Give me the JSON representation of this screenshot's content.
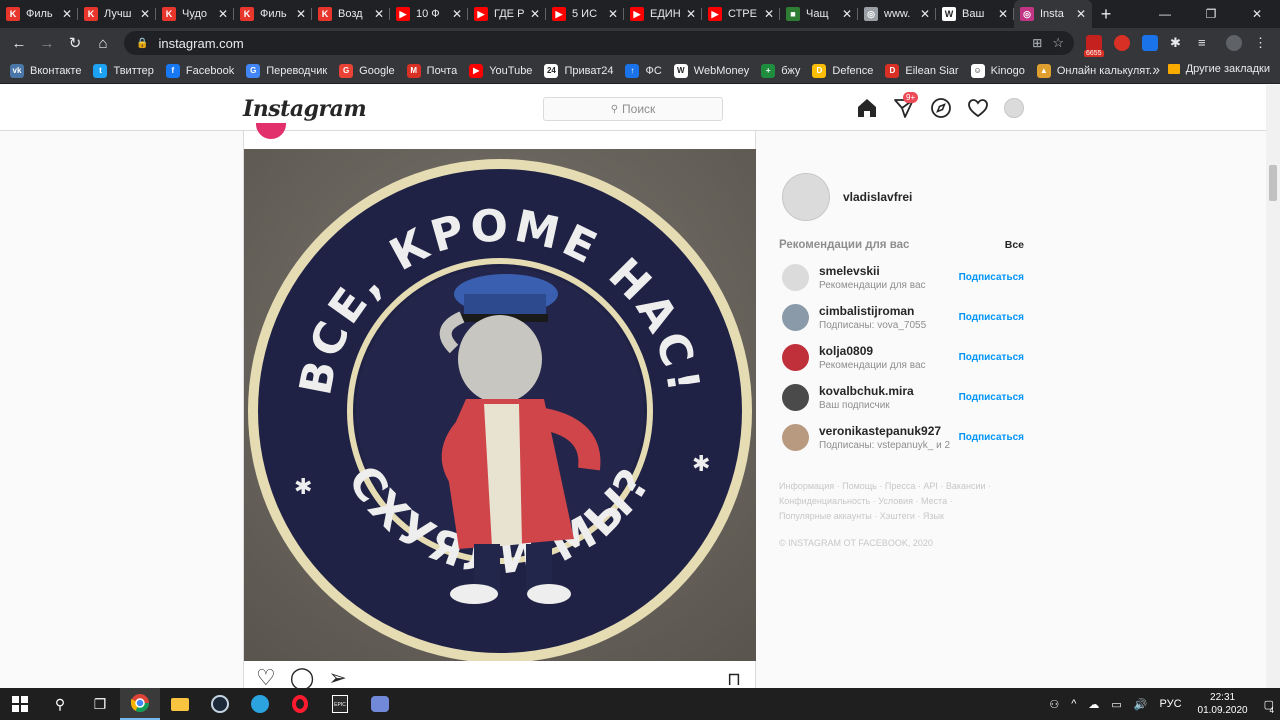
{
  "browser": {
    "tabs": [
      {
        "title": "Филь",
        "color": "#e8362d",
        "glyph": "K"
      },
      {
        "title": "Лучш",
        "color": "#e8362d",
        "glyph": "K"
      },
      {
        "title": "Чудо",
        "color": "#e8362d",
        "glyph": "K"
      },
      {
        "title": "Филь",
        "color": "#e8362d",
        "glyph": "K"
      },
      {
        "title": "Возд",
        "color": "#e8362d",
        "glyph": "K"
      },
      {
        "title": "10 Ф",
        "color": "#ff0000",
        "glyph": "▶"
      },
      {
        "title": "ГДЕ Р",
        "color": "#ff0000",
        "glyph": "▶"
      },
      {
        "title": "5 ИС",
        "color": "#ff0000",
        "glyph": "▶"
      },
      {
        "title": "ЕДИН",
        "color": "#ff0000",
        "glyph": "▶"
      },
      {
        "title": "СТРЕ",
        "color": "#ff0000",
        "glyph": "▶"
      },
      {
        "title": "Чащ",
        "color": "#2e7d32",
        "glyph": "■"
      },
      {
        "title": "www.",
        "color": "#9aa0a6",
        "glyph": "◎"
      },
      {
        "title": "Ваш",
        "color": "#ffffff",
        "glyph": "W"
      },
      {
        "title": "Insta",
        "color": "#c13584",
        "glyph": "◎"
      }
    ],
    "active_tab_index": 13,
    "url": "instagram.com",
    "ext_badge": "6655",
    "bookmarks": [
      {
        "label": "Вконтакте",
        "color": "#4a76a8",
        "glyph": "vk"
      },
      {
        "label": "Твиттер",
        "color": "#1da1f2",
        "glyph": "t"
      },
      {
        "label": "Facebook",
        "color": "#1877f2",
        "glyph": "f"
      },
      {
        "label": "Переводчик",
        "color": "#4285f4",
        "glyph": "G"
      },
      {
        "label": "Google",
        "color": "#ea4335",
        "glyph": "G"
      },
      {
        "label": "Почта",
        "color": "#d93025",
        "glyph": "M"
      },
      {
        "label": "YouTube",
        "color": "#ff0000",
        "glyph": "▶"
      },
      {
        "label": "Приват24",
        "color": "#ffffff",
        "glyph": "24"
      },
      {
        "label": "ФС",
        "color": "#1a73e8",
        "glyph": "↑"
      },
      {
        "label": "WebMoney",
        "color": "#ffffff",
        "glyph": "W"
      },
      {
        "label": "бжу",
        "color": "#1e8e3e",
        "glyph": "+"
      },
      {
        "label": "Defence",
        "color": "#fbbc04",
        "glyph": "D"
      },
      {
        "label": "Eilean Siar",
        "color": "#d93025",
        "glyph": "D"
      },
      {
        "label": "Kinogo",
        "color": "#ffffff",
        "glyph": "☺"
      },
      {
        "label": "Онлайн калькулят...",
        "color": "#e0a030",
        "glyph": "▲"
      }
    ],
    "bookmarks_more": "»",
    "other_bookmarks": "Другие закладки"
  },
  "instagram": {
    "logo": "Instagram",
    "search_placeholder": "Поиск",
    "notif_badge": "9+",
    "post": {
      "patch_top_text": "ВСЕ, КРОМЕ НАС!",
      "patch_bottom_text": "СХУЯЛИ МЫ?"
    },
    "sidebar": {
      "username": "vladislavfrei",
      "rec_title": "Рекомендации для вас",
      "rec_all": "Все",
      "follow_label": "Подписаться",
      "recommendations": [
        {
          "user": "smelevskii",
          "sub": "Рекомендации для вас",
          "color": "#dbdbdb"
        },
        {
          "user": "cimbalistijroman",
          "sub": "Подписаны: vova_7055",
          "color": "#8a9aa8"
        },
        {
          "user": "kolja0809",
          "sub": "Рекомендации для вас",
          "color": "#c0303a"
        },
        {
          "user": "kovalbchuk.mira",
          "sub": "Ваш подписчик",
          "color": "#4a4a4a"
        },
        {
          "user": "veronikastepanuk927",
          "sub": "Подписаны: vstepanuyk_ и 2",
          "color": "#b89a80"
        }
      ],
      "footer_line1": "Информация · Помощь · Пресса · API · Вакансии ·",
      "footer_line2": "Конфиденциальность · Условия · Места ·",
      "footer_line3": "Популярные аккаунты · Хэштеги · Язык",
      "copyright": "© INSTAGRAM OT FACEBOOK, 2020"
    }
  },
  "taskbar": {
    "lang": "РУС",
    "time": "22:31",
    "date": "01.09.2020",
    "notif_count": "4"
  }
}
